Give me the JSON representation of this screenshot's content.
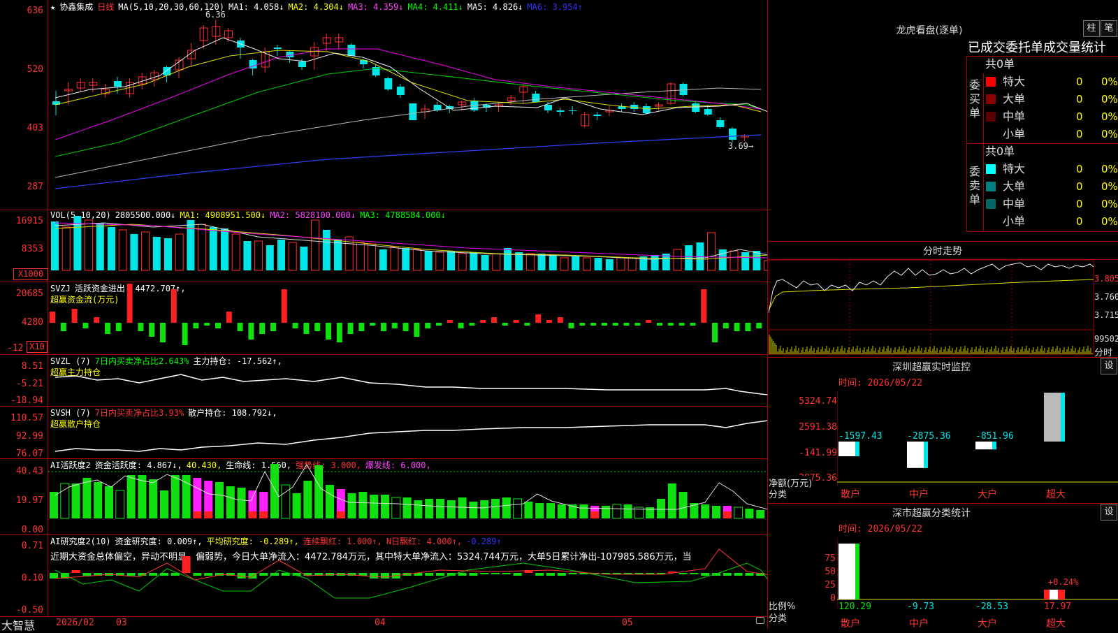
{
  "stock": {
    "name": "协鑫集成",
    "period": "日线",
    "ma_label": "MA(5,10,20,30,60,120)",
    "ma1": "MA1: 4.058↓",
    "ma2": "MA2: 4.304↓",
    "ma3": "MA3: 4.359↓",
    "ma4": "MA4: 4.411↓",
    "ma5": "MA5: 4.826↓",
    "ma6": "MA6: 3.954↑",
    "high_marker": "6.36",
    "low_marker": "3.69→",
    "axis": [
      "636",
      "520",
      "403",
      "287"
    ]
  },
  "vol": {
    "label": "VOL(5,10,20)",
    "value": "2805500.000↓",
    "ma1": "MA1: 4908951.500↓",
    "ma2": "MA2: 5828100.000↓",
    "ma3": "MA3: 4788584.000↓",
    "axis": [
      "16915",
      "8353"
    ],
    "unit": "X1000"
  },
  "svzj": {
    "label": "SVZJ",
    "active": "活跃资金进出: 4472.707↑,",
    "sub": "超赢资金流(万元)",
    "axis": [
      "20685",
      "4280",
      "-12"
    ],
    "unit": "X10"
  },
  "svzl": {
    "label": "SVZL (7)",
    "ratio": "7日内买卖净占比2.643%",
    "main": "主力持仓: -17.562↑,",
    "sub": "超赢主力持仓",
    "axis": [
      "8.51",
      "-5.21",
      "-18.94"
    ]
  },
  "svsh": {
    "label": "SVSH (7)",
    "ratio": "7日内买卖净占比3.93%",
    "main": "散户持仓: 108.792↓,",
    "sub": "超赢散户持仓",
    "axis": [
      "110.57",
      "92.99",
      "76.07"
    ]
  },
  "ai1": {
    "label": "AI活跃度2",
    "a": "资金活跃度: 4.867↓,",
    "b": "40.430,",
    "c": "生命线: 1.560,",
    "d": "强势线: 3.000,",
    "e": "爆发线: 6.000,",
    "axis": [
      "40.43",
      "19.97",
      "0.00"
    ]
  },
  "ai2": {
    "label": "AI研究度2(10)",
    "a": "资金研究度: 0.009↑,",
    "b": "平均研究度: -0.289↑,",
    "c": "连续飘红: 1.000↑,",
    "d": "N日飘红: 4.000↑,",
    "e": "-0.289↑",
    "comment": "近期大资金总体偏空，异动不明显，偏弱势，今日大单净流入：4472.784万元，其中特大单净流入：5324.744万元，大单5日累计净出-107985.586万元，当",
    "axis": [
      "0.71",
      "0.10",
      "-0.50"
    ]
  },
  "bottom": {
    "brand": "大智慧",
    "dates": [
      "2026/02",
      "03",
      "04",
      "05"
    ]
  },
  "right": {
    "lhb_title": "龙虎看盘(逐单)",
    "btn_zhu": "柱",
    "btn_bi": "笔",
    "table_title": "已成交委托单成交量统计",
    "buy_label": "委买单",
    "sell_label": "委卖单",
    "buy_total": "共0单",
    "sell_total": "共0单",
    "buy_rows": [
      {
        "name": "特大",
        "count": "0",
        "pct": "0%",
        "color": "#ff0000"
      },
      {
        "name": "大单",
        "count": "0",
        "pct": "0%",
        "color": "#8b0000"
      },
      {
        "name": "中单",
        "count": "0",
        "pct": "0%",
        "color": "#5a0000"
      },
      {
        "name": "小单",
        "count": "0",
        "pct": "0%",
        "color": ""
      }
    ],
    "sell_rows": [
      {
        "name": "特大",
        "count": "0",
        "pct": "0%",
        "color": "#00ffff"
      },
      {
        "name": "大单",
        "count": "0",
        "pct": "0%",
        "color": "#008080"
      },
      {
        "name": "中单",
        "count": "0",
        "pct": "0%",
        "color": "#006666"
      },
      {
        "name": "小单",
        "count": "0",
        "pct": "0%",
        "color": ""
      }
    ],
    "fenshi_title": "分时走势",
    "fenshi_axis": [
      "3.805",
      "3.760",
      "3.715",
      "99502",
      "分时"
    ],
    "monitor_title": "深圳超赢实时监控",
    "monitor_btn": "设",
    "monitor_time": "时间: 2026/05/22",
    "monitor_axis": [
      "5324.74",
      "2591.38",
      "-141.99",
      "-2875.36"
    ],
    "monitor_vals": [
      "-1597.43",
      "-2875.36",
      "-851.96",
      "5324.74"
    ],
    "monitor_ylabel": "净额(万元)",
    "monitor_xlabel": "分类",
    "categories": [
      "散户",
      "中户",
      "大户",
      "超大"
    ],
    "stat_title": "深市超赢分类统计",
    "stat_btn": "设",
    "stat_time": "时间: 2026/05/22",
    "stat_axis": [
      "75",
      "50",
      "25",
      "0"
    ],
    "stat_vals": [
      "120.29",
      "-9.73",
      "-28.53",
      "17.97"
    ],
    "stat_pct": "+0.24%",
    "stat_ylabel": "比例%",
    "stat_xlabel": "分类"
  }
}
